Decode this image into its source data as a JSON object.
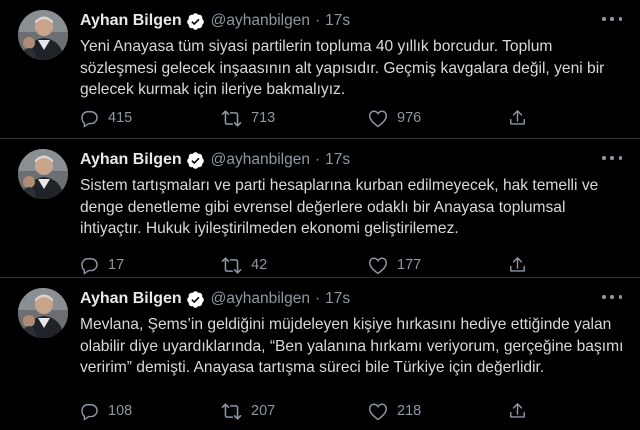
{
  "colors": {
    "background": "#000000",
    "text": "#d9d9d9",
    "secondary": "#8b98a5",
    "verified": "#ffffff",
    "divider": "#2f3336"
  },
  "tweets": [
    {
      "author": {
        "name": "Ayhan Bilgen",
        "handle": "@ayhanbilgen",
        "verified": true,
        "avatar_icon": "profile-photo"
      },
      "separator": "·",
      "time": "17s",
      "text": "Yeni Anayasa tüm siyasi partilerin topluma 40 yıllık borcudur. Toplum sözleşmesi gelecek inşaasının alt yapısıdır. Geçmiş kavgalara değil, yeni bir gelecek kurmak için ileriye bakmalıyız.",
      "replies": "415",
      "retweets": "713",
      "likes": "976"
    },
    {
      "author": {
        "name": "Ayhan Bilgen",
        "handle": "@ayhanbilgen",
        "verified": true,
        "avatar_icon": "profile-photo"
      },
      "separator": "·",
      "time": "17s",
      "text": "Sistem tartışmaları ve parti hesaplarına kurban edilmeyecek, hak temelli ve denge denetleme gibi evrensel değerlere odaklı bir Anayasa toplumsal ihtiyaçtır. Hukuk iyileştirilmeden ekonomi geliştirilemez.",
      "replies": "17",
      "retweets": "42",
      "likes": "177"
    },
    {
      "author": {
        "name": "Ayhan Bilgen",
        "handle": "@ayhanbilgen",
        "verified": true,
        "avatar_icon": "profile-photo"
      },
      "separator": "·",
      "time": "17s",
      "text": "Mevlana, Şems’in geldiğini müjdeleyen kişiye hırkasını hediye ettiğinde yalan olabilir diye uyardıklarında, “Ben yalanına hırkamı veriyorum, gerçeğine başımı veririm” demişti. Anayasa tartışma süreci bile Türkiye için değerlidir.",
      "replies": "108",
      "retweets": "207",
      "likes": "218"
    }
  ]
}
